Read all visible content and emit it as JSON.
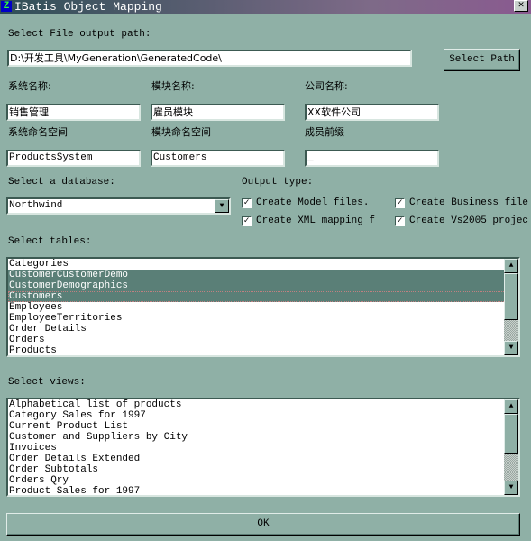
{
  "window": {
    "title": "IBatis Object Mapping",
    "icon": "Z",
    "close": "✕"
  },
  "path": {
    "label": "Select File output path:",
    "value": "D:\\开发工具\\MyGeneration\\GeneratedCode\\",
    "button": "Select Path"
  },
  "fields": [
    {
      "label": "系统名称:",
      "value": "销售管理"
    },
    {
      "label": "模块名称:",
      "value": "雇员模块"
    },
    {
      "label": "公司名称:",
      "value": "XX软件公司"
    },
    {
      "label": "系统命名空间",
      "value": "ProductsSystem"
    },
    {
      "label": "模块命名空间",
      "value": "Customers"
    },
    {
      "label": "成员前缀",
      "value": "_"
    }
  ],
  "database": {
    "label": "Select a database:",
    "value": "Northwind"
  },
  "output": {
    "label": "Output type:",
    "options": [
      {
        "label": "Create Model files.",
        "checked": true
      },
      {
        "label": "Create  Business file",
        "checked": true
      },
      {
        "label": "Create  XML mapping f",
        "checked": true
      },
      {
        "label": "Create Vs2005 projec",
        "checked": true
      }
    ]
  },
  "tables": {
    "label": "Select tables:",
    "items": [
      "Categories",
      "CustomerCustomerDemo",
      "CustomerDemographics",
      "Customers",
      "Employees",
      "EmployeeTerritories",
      "Order Details",
      "Orders",
      "Products"
    ],
    "selected": [
      1,
      2,
      3
    ],
    "focused": 3
  },
  "views": {
    "label": "Select views:",
    "items": [
      "Alphabetical list of products",
      "Category Sales for 1997",
      "Current Product List",
      "Customer and Suppliers by City",
      "Invoices",
      "Order Details Extended",
      "Order Subtotals",
      "Orders Qry",
      "Product Sales for 1997"
    ]
  },
  "ok": "OK",
  "colors": {
    "background": "#8fb0a6",
    "selection": "#5a7f77"
  }
}
